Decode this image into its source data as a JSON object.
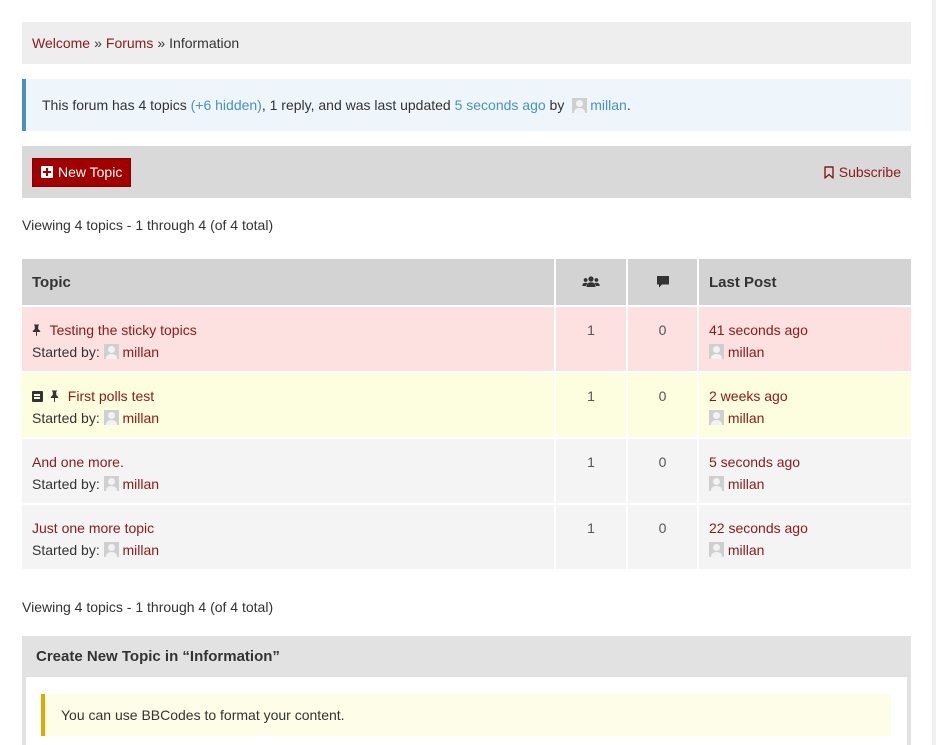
{
  "breadcrumb": {
    "items": [
      "Welcome",
      "Forums"
    ],
    "current": "Information",
    "separator": "»"
  },
  "notice": {
    "prefix": "This forum has 4 topics ",
    "hidden_link": "(+6 hidden)",
    "middle": ", 1 reply, and was last updated ",
    "updated_link": "5 seconds ago",
    "by": " by ",
    "user": "millan",
    "suffix": "."
  },
  "toolbar": {
    "new_topic_label": "New Topic",
    "subscribe_label": "Subscribe"
  },
  "viewing_text": "Viewing 4 topics - 1 through 4 (of 4 total)",
  "table": {
    "headers": {
      "topic": "Topic",
      "last_post": "Last Post"
    },
    "started_by_label": "Started by:",
    "rows": [
      {
        "title": "Testing the sticky topics",
        "author": "millan",
        "voices": "1",
        "posts": "0",
        "last_time": "41 seconds ago",
        "last_user": "millan"
      },
      {
        "title": "First polls test",
        "author": "millan",
        "voices": "1",
        "posts": "0",
        "last_time": "2 weeks ago",
        "last_user": "millan"
      },
      {
        "title": "And one more.",
        "author": "millan",
        "voices": "1",
        "posts": "0",
        "last_time": "5 seconds ago",
        "last_user": "millan"
      },
      {
        "title": "Just one more topic",
        "author": "millan",
        "voices": "1",
        "posts": "0",
        "last_time": "22 seconds ago",
        "last_user": "millan"
      }
    ]
  },
  "create": {
    "title": "Create New Topic in “Information”",
    "bbcode_note": "You can use BBCodes to format your content."
  },
  "colors": {
    "accent": "#a00000",
    "link_dark": "#8b1a1a",
    "link_blue": "#4a90c8",
    "sticky_row": "#fde0e0",
    "super_sticky_row": "#fdfde0",
    "plain_row": "#f4f4f4"
  },
  "icons": {
    "new_topic": "plus-square-icon",
    "subscribe": "bookmark-icon",
    "voices_header": "users-icon",
    "posts_header": "comment-icon",
    "sticky": "pin-icon",
    "poll": "poll-icon",
    "avatar": "avatar-icon"
  }
}
